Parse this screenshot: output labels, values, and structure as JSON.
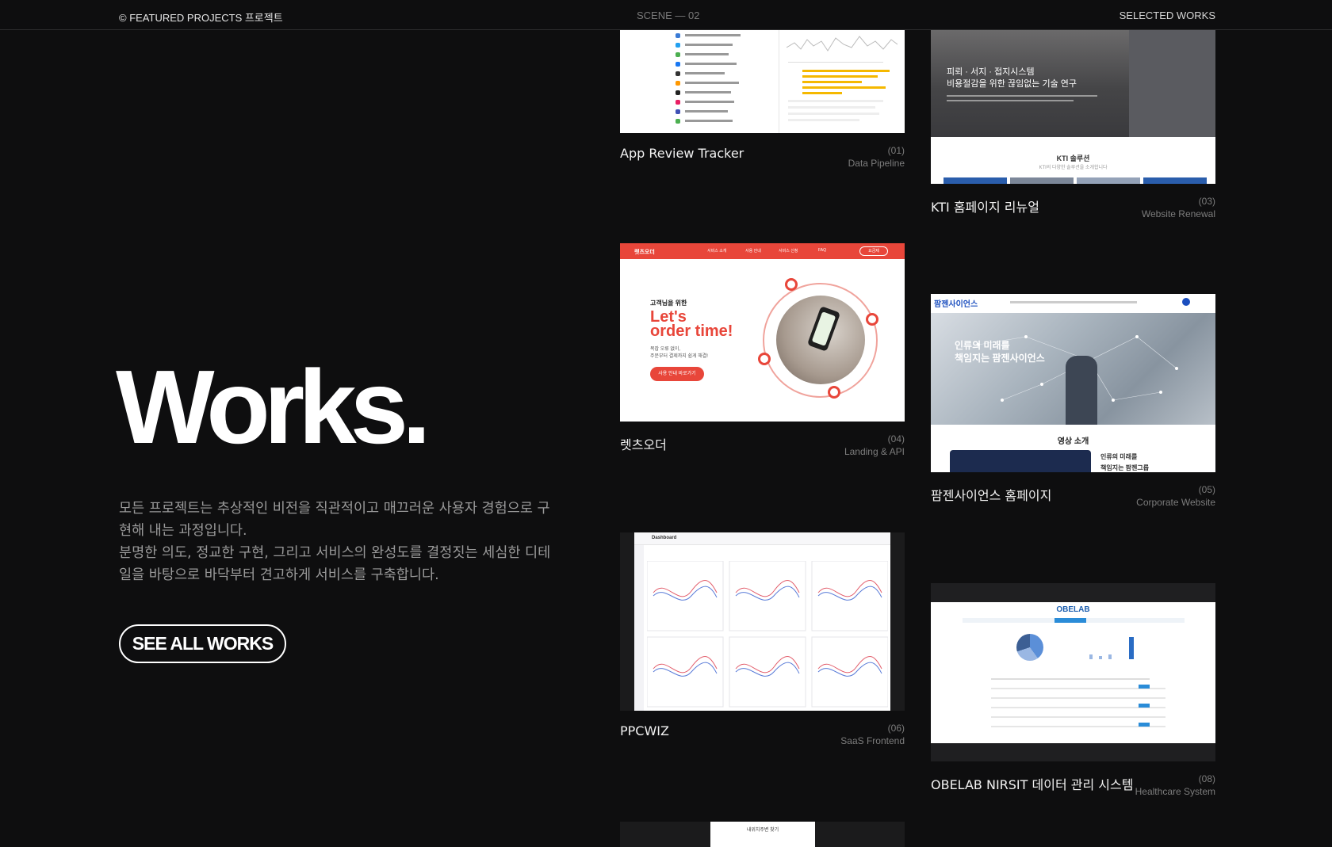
{
  "topbar": {
    "left": "© FEATURED PROJECTS 프로젝트",
    "center": "SCENE — 02",
    "right": "SELECTED WORKS"
  },
  "hero": {
    "title": "Works.",
    "description": [
      "모든 프로젝트는 추상적인 비전을 직관적이고 매끄러운 사용자 경험으로 구현해 내는 과정입니다.",
      "분명한 의도, 정교한 구현, 그리고 서비스의 완성도를 결정짓는 세심한 디테일을 바탕으로 바닥부터 견고하게 서비스를 구축합니다."
    ],
    "cta": "SEE ALL WORKS"
  },
  "projects": [
    {
      "title": "App Review Tracker",
      "number": "(01)",
      "category": "Data Pipeline"
    },
    {
      "title": "KTI 홈페이지 리뉴얼",
      "number": "(03)",
      "category": "Website Renewal"
    },
    {
      "title": "렛츠오더",
      "number": "(04)",
      "category": "Landing & API"
    },
    {
      "title": "팜젠사이언스 홈페이지",
      "number": "(05)",
      "category": "Corporate Website"
    },
    {
      "title": "PPCWIZ",
      "number": "(06)",
      "category": "SaaS Frontend"
    },
    {
      "title": "OBELAB NIRSIT 데이터 관리 시스템",
      "number": "(08)",
      "category": "Healthcare System"
    }
  ],
  "thumbs": {
    "kti": {
      "headline1": "피뢰 · 서지 · 접지시스템",
      "headline2": "비용절감을 위한 끊임없는 기술 연구",
      "section": "KTI 솔루션",
      "section_sub": "KTI의 다양한 솔루션을 소개합니다"
    },
    "letsorder": {
      "kicker": "고객님을 위한",
      "headline1": "Let's",
      "headline2": "order time!",
      "sub1": "복잡 오류 없이,",
      "sub2": "주문부터 결제까지 쉽게 해결!",
      "button": "사용 안내 바로가기",
      "nav": [
        "서비스 소개",
        "사용 안내",
        "서비스 신청",
        "FAQ"
      ],
      "nav_cta": "요금제",
      "logo": "렛츠오더"
    },
    "pharmgen": {
      "logo": "팜젠사이언스",
      "hero1": "인류의 미래를",
      "hero2": "책임지는 팜젠사이언스",
      "section": "영상 소개",
      "video_text1": "인류의 미래를",
      "video_text2": "책임지는 팜젠그룹"
    },
    "ppcwiz": {
      "header": "Dashboard"
    },
    "obelab": {
      "logo": "OBELAB"
    },
    "next": {
      "label": "내위치주변 찾기"
    }
  },
  "colors": {
    "background": "#0e0e0f",
    "letsorder_red": "#e8463a",
    "pharmgen_blue": "#1c4fbf",
    "obelab_blue": "#1d5fb0"
  }
}
